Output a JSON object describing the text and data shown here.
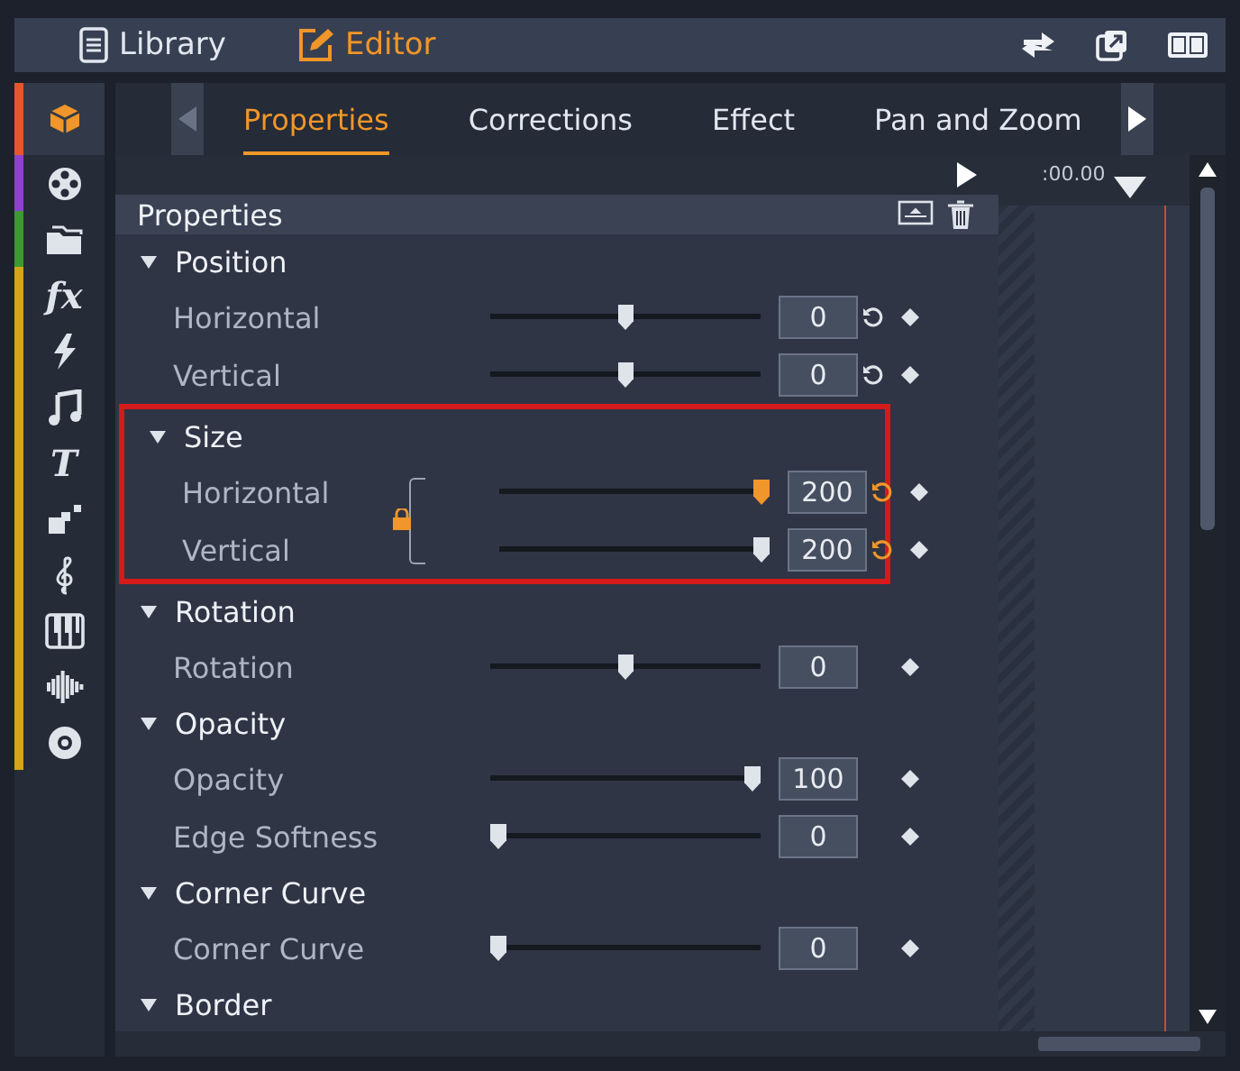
{
  "top_tabs": [
    {
      "label": "Library",
      "selected": false
    },
    {
      "label": "Editor",
      "selected": true
    }
  ],
  "rail": [
    {
      "kind": "icon",
      "color": "#e8552a",
      "selected": true
    },
    {
      "kind": "icon",
      "color": "#9040d0",
      "selected": false
    },
    {
      "kind": "icon",
      "color": "#3c9a30",
      "selected": false
    },
    {
      "kind": "glyph",
      "glyph": "fx",
      "color": "#d4a514",
      "selected": false
    },
    {
      "kind": "icon",
      "color": "#d4a514",
      "selected": false
    },
    {
      "kind": "icon",
      "color": "#d4a514",
      "selected": false
    },
    {
      "kind": "glyph",
      "glyph": "T",
      "color": "#d4a514",
      "selected": false
    },
    {
      "kind": "icon",
      "color": "#d4a514",
      "selected": false
    },
    {
      "kind": "icon",
      "color": "#d4a514",
      "selected": false
    },
    {
      "kind": "icon",
      "color": "#d4a514",
      "selected": false
    },
    {
      "kind": "icon",
      "color": "#d4a514",
      "selected": false
    },
    {
      "kind": "icon",
      "color": "#d4a514",
      "selected": false
    }
  ],
  "tabs": [
    {
      "label": "Properties",
      "selected": true
    },
    {
      "label": "Corrections",
      "selected": false
    },
    {
      "label": "Effect",
      "selected": false
    },
    {
      "label": "Pan and Zoom",
      "selected": false
    }
  ],
  "timeline": {
    "time": ":00.00"
  },
  "panel": {
    "title": "Properties"
  },
  "groups": [
    {
      "title": "Position",
      "expanded": true,
      "rows": [
        {
          "kind": "reset",
          "label": "Horizontal",
          "level": 0.5,
          "value": "0",
          "changed": false,
          "active": false
        },
        {
          "kind": "reset",
          "label": "Vertical",
          "level": 0.5,
          "value": "0",
          "changed": false,
          "active": false
        }
      ]
    },
    {
      "title": "Size",
      "expanded": true,
      "highlighted": true,
      "linked": true,
      "rows": [
        {
          "kind": "reset",
          "label": "Horizontal",
          "level": 1,
          "value": "200",
          "changed": true,
          "active": true
        },
        {
          "kind": "reset",
          "label": "Vertical",
          "level": 1,
          "value": "200",
          "changed": true,
          "active": false
        }
      ]
    },
    {
      "title": "Rotation",
      "expanded": true,
      "rows": [
        {
          "kind": "plain",
          "label": "Rotation",
          "level": 0.5,
          "value": "0",
          "active": false
        }
      ]
    },
    {
      "title": "Opacity",
      "expanded": true,
      "rows": [
        {
          "kind": "plain",
          "label": "Opacity",
          "level": 1,
          "value": "100",
          "active": false
        },
        {
          "kind": "plain",
          "label": "Edge Softness",
          "level": 0,
          "value": "0",
          "active": false
        }
      ]
    },
    {
      "title": "Corner Curve",
      "expanded": true,
      "rows": [
        {
          "kind": "plain",
          "label": "Corner Curve",
          "level": 0,
          "value": "0",
          "active": false
        }
      ]
    },
    {
      "title": "Border",
      "expanded": true
    }
  ]
}
